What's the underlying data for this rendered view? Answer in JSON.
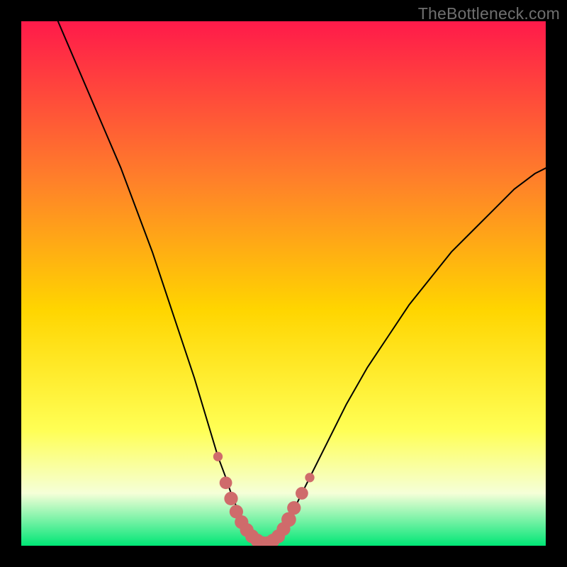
{
  "watermark": "TheBottleneck.com",
  "colors": {
    "frame": "#000000",
    "grad_top": "#ff1a4a",
    "grad_mid1": "#ff7f2a",
    "grad_mid2": "#ffd500",
    "grad_mid3": "#ffff55",
    "grad_mid4": "#f5ffd8",
    "grad_bottom": "#00e676",
    "curve": "#000000",
    "marker_fill": "#cf6b6b",
    "marker_stroke": "#cf6b6b"
  },
  "chart_data": {
    "type": "line",
    "title": "",
    "xlabel": "",
    "ylabel": "",
    "xlim": [
      0,
      100
    ],
    "ylim": [
      0,
      100
    ],
    "curve": {
      "x": [
        7,
        10,
        13,
        16,
        19,
        22,
        25,
        27,
        29,
        31,
        33,
        34.5,
        36,
        37.5,
        39,
        40,
        41,
        42,
        43,
        44,
        45,
        46,
        47,
        48,
        49,
        50,
        51.5,
        53,
        55,
        58,
        62,
        66,
        70,
        74,
        78,
        82,
        86,
        90,
        94,
        98,
        100
      ],
      "y": [
        100,
        93,
        86,
        79,
        72,
        64,
        56,
        50,
        44,
        38,
        32,
        27,
        22,
        17,
        13,
        10,
        7.5,
        5.2,
        3.5,
        2.1,
        1.2,
        0.5,
        0.5,
        1.2,
        2.1,
        3.5,
        5.8,
        9,
        13,
        19,
        27,
        34,
        40,
        46,
        51,
        56,
        60,
        64,
        68,
        71,
        72
      ]
    },
    "markers": [
      {
        "x": 37.5,
        "y": 17,
        "r": 0.9
      },
      {
        "x": 39,
        "y": 12,
        "r": 1.2
      },
      {
        "x": 40,
        "y": 9,
        "r": 1.3
      },
      {
        "x": 41,
        "y": 6.5,
        "r": 1.3
      },
      {
        "x": 42,
        "y": 4.5,
        "r": 1.3
      },
      {
        "x": 43,
        "y": 3,
        "r": 1.3
      },
      {
        "x": 44,
        "y": 1.8,
        "r": 1.3
      },
      {
        "x": 45,
        "y": 1.0,
        "r": 1.3
      },
      {
        "x": 46,
        "y": 0.5,
        "r": 1.3
      },
      {
        "x": 47,
        "y": 0.5,
        "r": 1.3
      },
      {
        "x": 48,
        "y": 1.0,
        "r": 1.3
      },
      {
        "x": 49,
        "y": 1.8,
        "r": 1.3
      },
      {
        "x": 50,
        "y": 3.2,
        "r": 1.3
      },
      {
        "x": 51,
        "y": 5.0,
        "r": 1.4
      },
      {
        "x": 52,
        "y": 7.2,
        "r": 1.3
      },
      {
        "x": 53.5,
        "y": 10,
        "r": 1.2
      },
      {
        "x": 55,
        "y": 13,
        "r": 0.9
      }
    ]
  }
}
